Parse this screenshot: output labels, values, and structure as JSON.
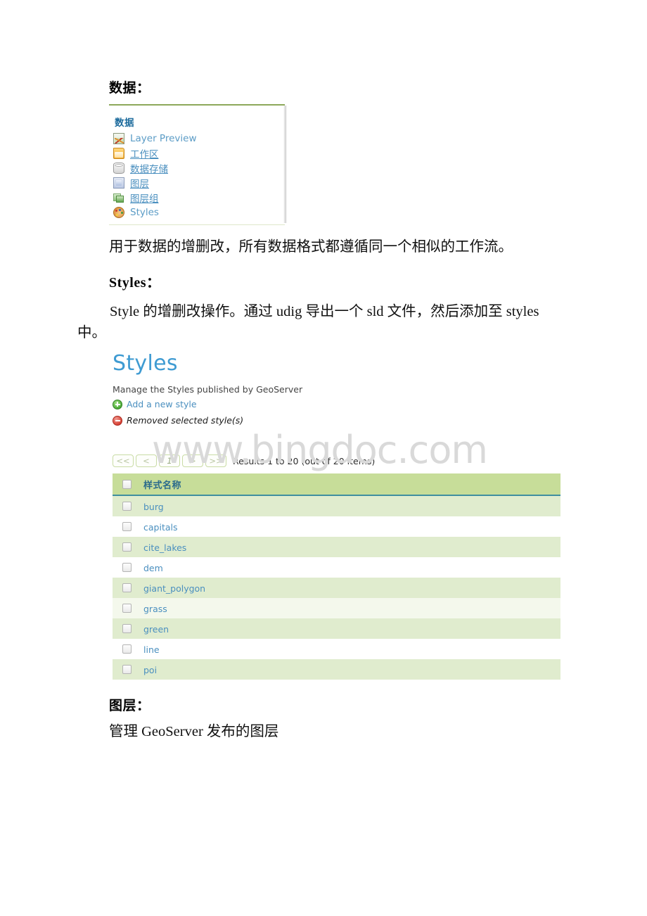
{
  "document": {
    "heading_data": "数据：",
    "paragraph_data": "用于数据的增删改，所有数据格式都遵循同一个相似的工作流。",
    "heading_styles": "Styles：",
    "paragraph_styles": "Style 的增删改操作。通过 udig 导出一个 sld 文件，然后添加至 styles 中。",
    "heading_layers": "图层：",
    "paragraph_layers": "管理 GeoServer 发布的图层",
    "watermark": "www.bingdoc.com"
  },
  "data_panel": {
    "title": "数据",
    "items": [
      {
        "label": "Layer Preview",
        "icon": "layer-preview-icon"
      },
      {
        "label": "工作区",
        "icon": "workspace-folder-icon"
      },
      {
        "label": "数据存储",
        "icon": "datastore-database-icon"
      },
      {
        "label": "图层",
        "icon": "layer-icon"
      },
      {
        "label": "图层组",
        "icon": "layergroup-icon"
      },
      {
        "label": "Styles",
        "icon": "styles-palette-icon"
      }
    ]
  },
  "styles_page": {
    "title": "Styles",
    "subtitle": "Manage the Styles published by GeoServer",
    "add_label": "Add a new style",
    "remove_label": "Removed selected style(s)",
    "pager": {
      "first": "<<",
      "prev": "<",
      "current": "1",
      "next": ">",
      "last": ">>",
      "results": "Results 1 to 20 (out of 20 items)"
    },
    "table": {
      "column_header": "样式名称",
      "rows": [
        {
          "name": "burg",
          "shade": "alt"
        },
        {
          "name": "capitals",
          "shade": "plain"
        },
        {
          "name": "cite_lakes",
          "shade": "alt"
        },
        {
          "name": "dem",
          "shade": "plain"
        },
        {
          "name": "giant_polygon",
          "shade": "alt"
        },
        {
          "name": "grass",
          "shade": "faint"
        },
        {
          "name": "green",
          "shade": "alt"
        },
        {
          "name": "line",
          "shade": "plain"
        },
        {
          "name": "poi",
          "shade": "alt"
        }
      ]
    }
  },
  "colors": {
    "accent_blue": "#3f9bd2",
    "link_blue": "#4a8fbf",
    "header_green": "#c7dd99",
    "row_green": "#e0ecce",
    "row_faint": "#f4f8ec",
    "teal_rule": "#3f8fa0",
    "panel_rule": "#8ca85a"
  }
}
